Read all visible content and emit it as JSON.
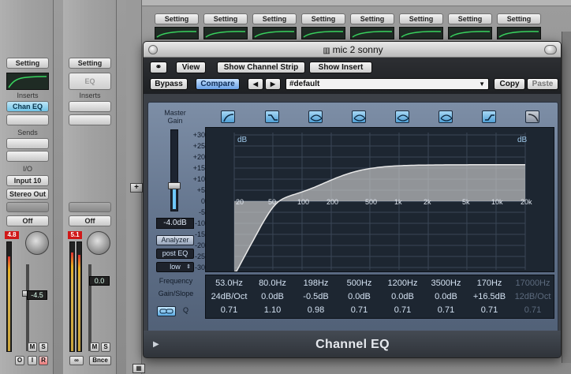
{
  "mixer": {
    "top_setting_labels": [
      "Setting",
      "Setting",
      "Setting",
      "Setting",
      "Setting",
      "Setting",
      "Setting",
      "Setting"
    ],
    "strip1": {
      "setting": "Setting",
      "inserts_label": "Inserts",
      "insert1": "Chan EQ",
      "sends_label": "Sends",
      "io_label": "I/O",
      "input": "Input 10",
      "output": "Stereo Out",
      "automation": "Off",
      "peak": "4.8",
      "fader_value": "-4.5",
      "m": "M",
      "s": "S",
      "o": "O",
      "i": "I",
      "r": "R"
    },
    "strip2": {
      "setting": "Setting",
      "eq": "EQ",
      "inserts_label": "Inserts",
      "automation": "Off",
      "peak": "5.1",
      "fader_value": "0.0",
      "m": "M",
      "s": "S",
      "bnce": "Bnce"
    }
  },
  "plugin": {
    "title": "mic 2 sonny",
    "toolbar": {
      "view": "View",
      "show_channel_strip": "Show Channel Strip",
      "show_insert": "Show Insert",
      "bypass": "Bypass",
      "compare": "Compare",
      "prev": "◀",
      "next": "▶",
      "preset": "#default",
      "copy": "Copy",
      "paste": "Paste"
    },
    "master_gain": {
      "label": "Master Gain",
      "value": "-4.0dB"
    },
    "analyzer": {
      "label": "Analyzer",
      "mode": "post EQ",
      "resolution": "low"
    },
    "graph": {
      "db_unit": "dB",
      "db_ticks": [
        "+30",
        "+25",
        "+20",
        "+15",
        "+10",
        "+5",
        "0",
        "-5",
        "-10",
        "-15",
        "-20",
        "-25",
        "-30"
      ],
      "freq_ticks": [
        "20",
        "50",
        "100",
        "200",
        "500",
        "1k",
        "2k",
        "5k",
        "10k",
        "20k"
      ]
    },
    "params": {
      "labels": {
        "frequency": "Frequency",
        "gain_slope": "Gain/Slope",
        "q": "Q"
      },
      "frequency": [
        "53.0Hz",
        "80.0Hz",
        "198Hz",
        "500Hz",
        "1200Hz",
        "3500Hz",
        "170Hz",
        "17000Hz"
      ],
      "gain": [
        "24dB/Oct",
        "0.0dB",
        "-0.5dB",
        "0.0dB",
        "0.0dB",
        "0.0dB",
        "+16.5dB",
        "12dB/Oct"
      ],
      "q": [
        "0.71",
        "1.10",
        "0.98",
        "0.71",
        "0.71",
        "0.71",
        "0.71",
        "0.71"
      ],
      "band_enabled": [
        true,
        true,
        true,
        true,
        true,
        true,
        true,
        false
      ]
    },
    "footer_title": "Channel EQ"
  },
  "colors": {
    "accent_blue": "#6fc3e6",
    "eq_curve": "#cfcfcf",
    "peak_red": "#d01818"
  }
}
